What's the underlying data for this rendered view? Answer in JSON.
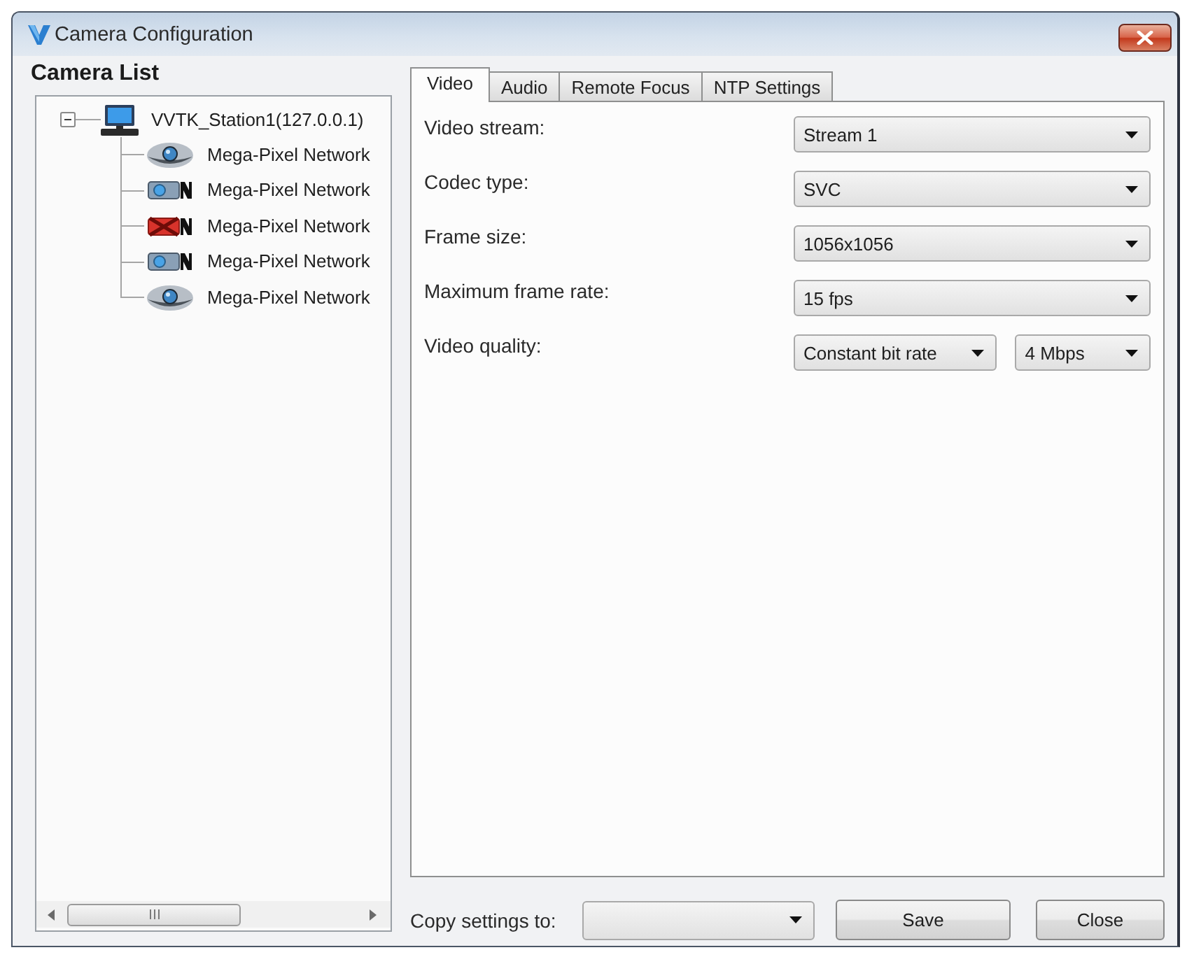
{
  "window": {
    "title": "Camera Configuration"
  },
  "camera_list": {
    "title": "Camera List",
    "tree": [
      {
        "label": "VVTK_Station1(127.0.0.1)",
        "kind": "station",
        "expanded": true,
        "children": [
          {
            "label": "Mega-Pixel Network",
            "kind": "dome",
            "offline": false
          },
          {
            "label": "Mega-Pixel Network",
            "kind": "box",
            "offline": false
          },
          {
            "label": "Mega-Pixel Network",
            "kind": "box",
            "offline": true
          },
          {
            "label": "Mega-Pixel Network",
            "kind": "box",
            "offline": false
          },
          {
            "label": "Mega-Pixel Network",
            "kind": "dome",
            "offline": false
          }
        ]
      }
    ]
  },
  "tabs": [
    {
      "label": "Video",
      "selected": true
    },
    {
      "label": "Audio",
      "selected": false
    },
    {
      "label": "Remote Focus",
      "selected": false
    },
    {
      "label": "NTP Settings",
      "selected": false
    }
  ],
  "video_settings": [
    {
      "label": "Video stream:",
      "selects": [
        "Stream 1"
      ]
    },
    {
      "label": "Codec type:",
      "selects": [
        "SVC"
      ]
    },
    {
      "label": "Frame size:",
      "selects": [
        "1056x1056"
      ]
    },
    {
      "label": "Maximum frame rate:",
      "selects": [
        "15 fps"
      ]
    },
    {
      "label": "Video quality:",
      "selects": [
        "Constant bit rate",
        "4 Mbps"
      ]
    }
  ],
  "copy_settings": {
    "label": "Copy settings to:"
  },
  "buttons": [
    "Save",
    "Close"
  ]
}
